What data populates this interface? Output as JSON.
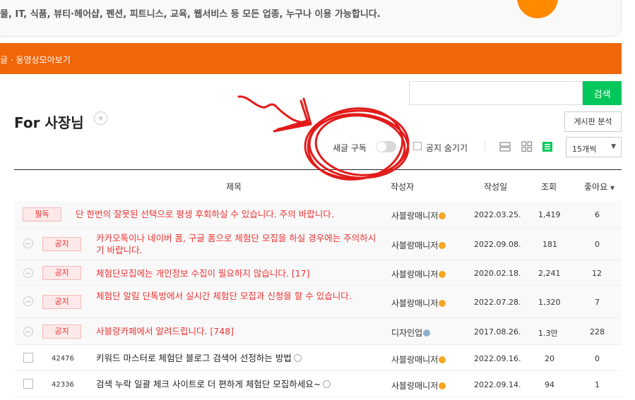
{
  "top": {
    "line1": "",
    "line2": "물, IT, 식품, 뷰티·헤어샵, 펜션, 피트니스, 교육, 웹서비스 등 모든 업종, 누구나 이용 가능합니다."
  },
  "nav": {
    "text": "글  ·  동영상모아보기"
  },
  "search": {
    "placeholder": "",
    "button": "검색"
  },
  "board": {
    "title": "For 사장님",
    "analyze": "게시판 분석"
  },
  "controls": {
    "subscribe": "새글 구독",
    "hide_notice": "공지 숨기기",
    "per_page": "15개씩"
  },
  "columns": {
    "title": "제목",
    "author": "작성자",
    "date": "작성일",
    "views": "조회",
    "likes": "좋아요"
  },
  "rows": [
    {
      "badge": "필독",
      "title": "단 한번의 잘못된 선택으로 평생 후회하실 수 있습니다. 주의 바랍니다.",
      "author": "사블랑매니저",
      "date": "2022.03.25.",
      "views": "1,419",
      "likes": "6"
    },
    {
      "badge": "공지",
      "title": "카카오톡이나 네이버 폼, 구글 폼으로 체험단 모집을 하실 경우에는 주의하시기 바랍니다.",
      "author": "사블랑매니저",
      "date": "2022.09.08.",
      "views": "181",
      "likes": "0"
    },
    {
      "badge": "공지",
      "title": "체험단모집에는 개인정보 수집이 필요하지 않습니다. [17]",
      "author": "사블랑매니저",
      "date": "2020.02.18.",
      "views": "2,241",
      "likes": "12"
    },
    {
      "badge": "공지",
      "title": "체험단 알림 단톡방에서 실시간 체험단 모집과 신청을 할 수 있습니다.",
      "author": "사블랑매니저",
      "date": "2022.07.28.",
      "views": "1,320",
      "likes": "7"
    },
    {
      "badge": "공지",
      "title": "사블랑카페에서 알려드립니다. [748]",
      "author": "디자인업",
      "date": "2017.08.26.",
      "views": "1.3만",
      "likes": "228"
    },
    {
      "num": "42476",
      "title": "키워드 마스터로 체험단 블로그 검색어 선정하는 방법",
      "author": "사블랑매니저",
      "date": "2022.09.16.",
      "views": "20",
      "likes": "0"
    },
    {
      "num": "42336",
      "title": "검색 누락 일괄 체크 사이트로 더 편하게 체험단 모집하세요~",
      "author": "사블랑매니저",
      "date": "2022.09.14.",
      "views": "94",
      "likes": "1"
    }
  ],
  "colors": {
    "accent_orange": "#f0670a",
    "search_green": "#03c75a",
    "notice_red": "#e33333",
    "annotation_red": "#e21b1b"
  }
}
